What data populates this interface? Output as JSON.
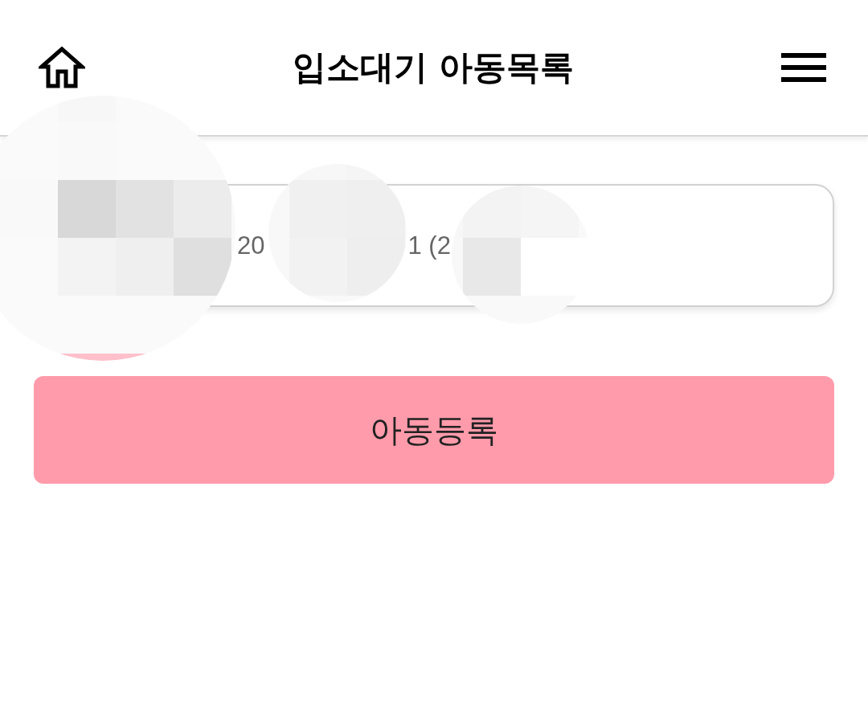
{
  "header": {
    "title": "입소대기 아동목록"
  },
  "card": {
    "text_fragments": [
      "20",
      "1 (2"
    ]
  },
  "register_button": {
    "label": "아동등록"
  }
}
